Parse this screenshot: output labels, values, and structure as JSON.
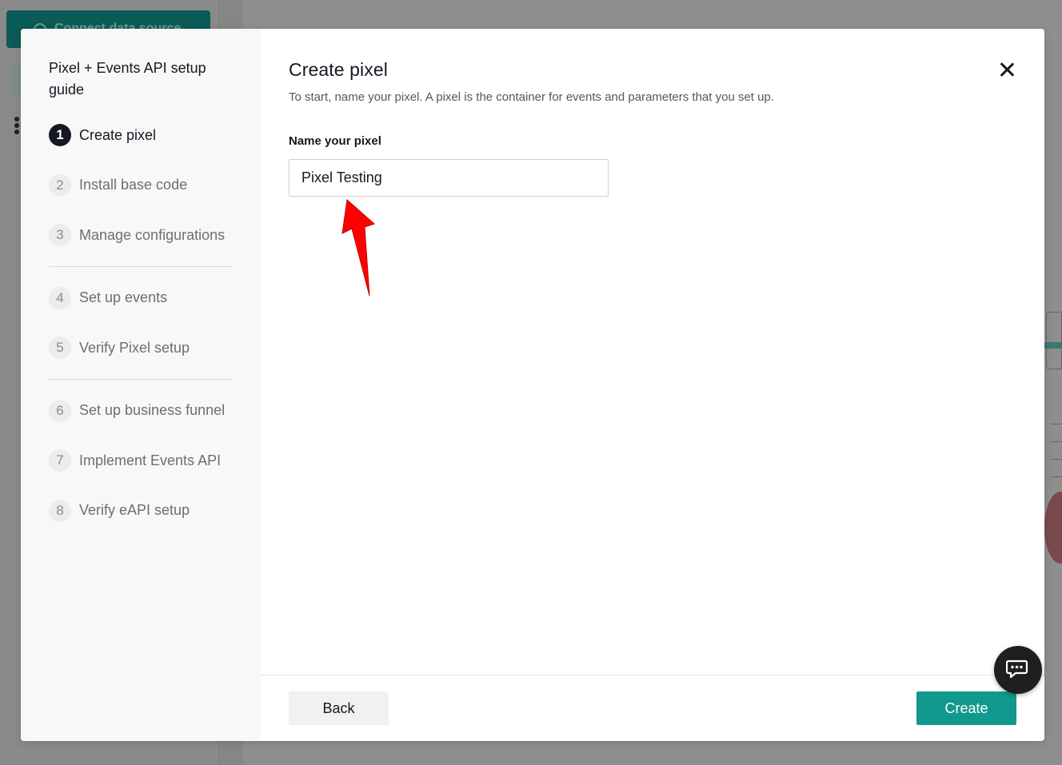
{
  "background": {
    "connect_button_label": "Connect data source"
  },
  "guide": {
    "title": "Pixel + Events API setup guide",
    "steps": [
      {
        "num": "1",
        "label": "Create pixel"
      },
      {
        "num": "2",
        "label": "Install base code"
      },
      {
        "num": "3",
        "label": "Manage configurations"
      },
      {
        "num": "4",
        "label": "Set up events"
      },
      {
        "num": "5",
        "label": "Verify Pixel setup"
      },
      {
        "num": "6",
        "label": "Set up business funnel"
      },
      {
        "num": "7",
        "label": "Implement Events API"
      },
      {
        "num": "8",
        "label": "Verify eAPI setup"
      }
    ],
    "active_step": "1"
  },
  "content": {
    "title": "Create pixel",
    "description": "To start, name your pixel. A pixel is the container for events and parameters that you set up.",
    "field_label": "Name your pixel",
    "input_value": "Pixel Testing"
  },
  "footer": {
    "back_label": "Back",
    "create_label": "Create"
  },
  "colors": {
    "accent": "#11998e",
    "annotation_arrow": "#ff0000"
  },
  "icons": {
    "close": "close-icon",
    "chat": "chat-icon",
    "annotation": "red-arrow-icon"
  }
}
